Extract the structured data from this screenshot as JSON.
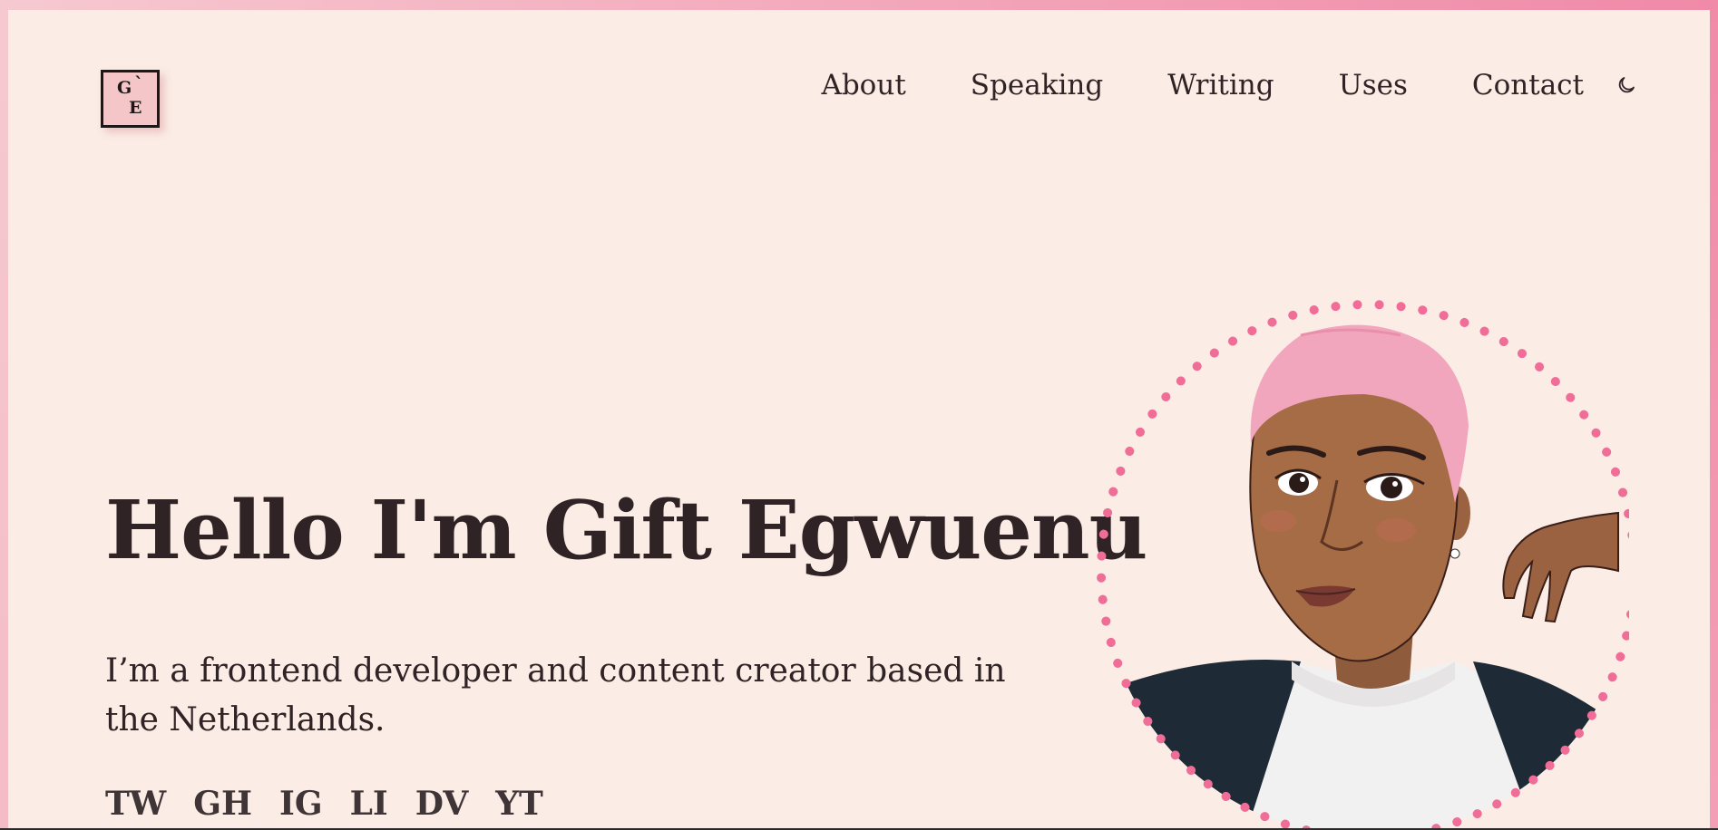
{
  "logo": {
    "letter_top": "G",
    "mark": "`",
    "letter_bottom": "E",
    "background": "#f4c6c8"
  },
  "nav": {
    "items": [
      {
        "label": "About"
      },
      {
        "label": "Speaking"
      },
      {
        "label": "Writing"
      },
      {
        "label": "Uses"
      },
      {
        "label": "Contact"
      }
    ],
    "theme_icon": "moon-icon"
  },
  "hero": {
    "title": "Hello I'm Gift Egwuenu",
    "subtitle": "I’m a frontend developer and content creator based in the Netherlands.",
    "avatar_icon": "avatar-illustration"
  },
  "social": {
    "links": [
      {
        "label": "TW"
      },
      {
        "label": "GH"
      },
      {
        "label": "IG"
      },
      {
        "label": "LI"
      },
      {
        "label": "DV"
      },
      {
        "label": "YT"
      }
    ]
  },
  "colors": {
    "background": "#fbece5",
    "accent": "#f06d98",
    "text": "#2f2325",
    "frame_start": "#f6c9d0",
    "frame_end": "#f08aa8"
  }
}
